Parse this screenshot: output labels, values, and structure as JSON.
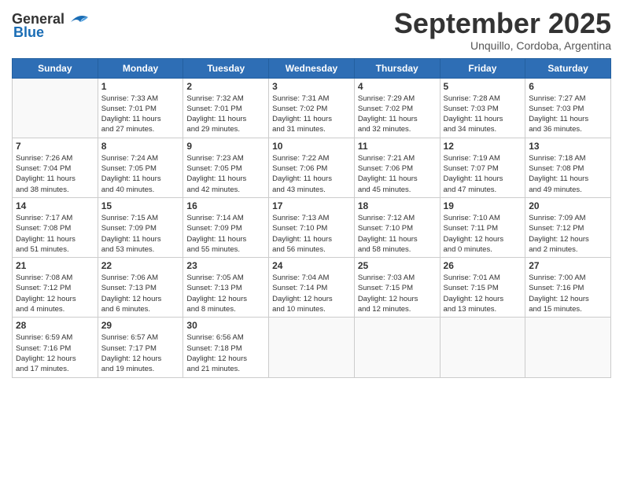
{
  "header": {
    "logo_general": "General",
    "logo_blue": "Blue",
    "month": "September 2025",
    "location": "Unquillo, Cordoba, Argentina"
  },
  "weekdays": [
    "Sunday",
    "Monday",
    "Tuesday",
    "Wednesday",
    "Thursday",
    "Friday",
    "Saturday"
  ],
  "weeks": [
    [
      {
        "day": "",
        "info": ""
      },
      {
        "day": "1",
        "info": "Sunrise: 7:33 AM\nSunset: 7:01 PM\nDaylight: 11 hours\nand 27 minutes."
      },
      {
        "day": "2",
        "info": "Sunrise: 7:32 AM\nSunset: 7:01 PM\nDaylight: 11 hours\nand 29 minutes."
      },
      {
        "day": "3",
        "info": "Sunrise: 7:31 AM\nSunset: 7:02 PM\nDaylight: 11 hours\nand 31 minutes."
      },
      {
        "day": "4",
        "info": "Sunrise: 7:29 AM\nSunset: 7:02 PM\nDaylight: 11 hours\nand 32 minutes."
      },
      {
        "day": "5",
        "info": "Sunrise: 7:28 AM\nSunset: 7:03 PM\nDaylight: 11 hours\nand 34 minutes."
      },
      {
        "day": "6",
        "info": "Sunrise: 7:27 AM\nSunset: 7:03 PM\nDaylight: 11 hours\nand 36 minutes."
      }
    ],
    [
      {
        "day": "7",
        "info": "Sunrise: 7:26 AM\nSunset: 7:04 PM\nDaylight: 11 hours\nand 38 minutes."
      },
      {
        "day": "8",
        "info": "Sunrise: 7:24 AM\nSunset: 7:05 PM\nDaylight: 11 hours\nand 40 minutes."
      },
      {
        "day": "9",
        "info": "Sunrise: 7:23 AM\nSunset: 7:05 PM\nDaylight: 11 hours\nand 42 minutes."
      },
      {
        "day": "10",
        "info": "Sunrise: 7:22 AM\nSunset: 7:06 PM\nDaylight: 11 hours\nand 43 minutes."
      },
      {
        "day": "11",
        "info": "Sunrise: 7:21 AM\nSunset: 7:06 PM\nDaylight: 11 hours\nand 45 minutes."
      },
      {
        "day": "12",
        "info": "Sunrise: 7:19 AM\nSunset: 7:07 PM\nDaylight: 11 hours\nand 47 minutes."
      },
      {
        "day": "13",
        "info": "Sunrise: 7:18 AM\nSunset: 7:08 PM\nDaylight: 11 hours\nand 49 minutes."
      }
    ],
    [
      {
        "day": "14",
        "info": "Sunrise: 7:17 AM\nSunset: 7:08 PM\nDaylight: 11 hours\nand 51 minutes."
      },
      {
        "day": "15",
        "info": "Sunrise: 7:15 AM\nSunset: 7:09 PM\nDaylight: 11 hours\nand 53 minutes."
      },
      {
        "day": "16",
        "info": "Sunrise: 7:14 AM\nSunset: 7:09 PM\nDaylight: 11 hours\nand 55 minutes."
      },
      {
        "day": "17",
        "info": "Sunrise: 7:13 AM\nSunset: 7:10 PM\nDaylight: 11 hours\nand 56 minutes."
      },
      {
        "day": "18",
        "info": "Sunrise: 7:12 AM\nSunset: 7:10 PM\nDaylight: 11 hours\nand 58 minutes."
      },
      {
        "day": "19",
        "info": "Sunrise: 7:10 AM\nSunset: 7:11 PM\nDaylight: 12 hours\nand 0 minutes."
      },
      {
        "day": "20",
        "info": "Sunrise: 7:09 AM\nSunset: 7:12 PM\nDaylight: 12 hours\nand 2 minutes."
      }
    ],
    [
      {
        "day": "21",
        "info": "Sunrise: 7:08 AM\nSunset: 7:12 PM\nDaylight: 12 hours\nand 4 minutes."
      },
      {
        "day": "22",
        "info": "Sunrise: 7:06 AM\nSunset: 7:13 PM\nDaylight: 12 hours\nand 6 minutes."
      },
      {
        "day": "23",
        "info": "Sunrise: 7:05 AM\nSunset: 7:13 PM\nDaylight: 12 hours\nand 8 minutes."
      },
      {
        "day": "24",
        "info": "Sunrise: 7:04 AM\nSunset: 7:14 PM\nDaylight: 12 hours\nand 10 minutes."
      },
      {
        "day": "25",
        "info": "Sunrise: 7:03 AM\nSunset: 7:15 PM\nDaylight: 12 hours\nand 12 minutes."
      },
      {
        "day": "26",
        "info": "Sunrise: 7:01 AM\nSunset: 7:15 PM\nDaylight: 12 hours\nand 13 minutes."
      },
      {
        "day": "27",
        "info": "Sunrise: 7:00 AM\nSunset: 7:16 PM\nDaylight: 12 hours\nand 15 minutes."
      }
    ],
    [
      {
        "day": "28",
        "info": "Sunrise: 6:59 AM\nSunset: 7:16 PM\nDaylight: 12 hours\nand 17 minutes."
      },
      {
        "day": "29",
        "info": "Sunrise: 6:57 AM\nSunset: 7:17 PM\nDaylight: 12 hours\nand 19 minutes."
      },
      {
        "day": "30",
        "info": "Sunrise: 6:56 AM\nSunset: 7:18 PM\nDaylight: 12 hours\nand 21 minutes."
      },
      {
        "day": "",
        "info": ""
      },
      {
        "day": "",
        "info": ""
      },
      {
        "day": "",
        "info": ""
      },
      {
        "day": "",
        "info": ""
      }
    ]
  ]
}
